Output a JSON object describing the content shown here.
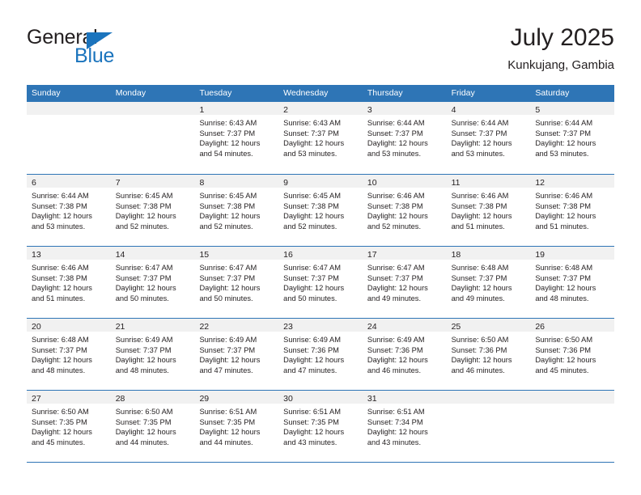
{
  "brand": {
    "name_top": "General",
    "name_bottom": "Blue",
    "triangle_color": "#1b74bd"
  },
  "header": {
    "title": "July 2025",
    "subtitle": "Kunkujang, Gambia"
  },
  "theme": {
    "header_blue": "#2e75b6",
    "daynum_strip": "#f1f1f1",
    "text": "#231f20"
  },
  "weekday_labels": [
    "Sunday",
    "Monday",
    "Tuesday",
    "Wednesday",
    "Thursday",
    "Friday",
    "Saturday"
  ],
  "weeks": [
    [
      {
        "day": "",
        "sunrise": "",
        "sunset": "",
        "daylight": ""
      },
      {
        "day": "",
        "sunrise": "",
        "sunset": "",
        "daylight": ""
      },
      {
        "day": "1",
        "sunrise": "Sunrise: 6:43 AM",
        "sunset": "Sunset: 7:37 PM",
        "daylight": "Daylight: 12 hours and 54 minutes."
      },
      {
        "day": "2",
        "sunrise": "Sunrise: 6:43 AM",
        "sunset": "Sunset: 7:37 PM",
        "daylight": "Daylight: 12 hours and 53 minutes."
      },
      {
        "day": "3",
        "sunrise": "Sunrise: 6:44 AM",
        "sunset": "Sunset: 7:37 PM",
        "daylight": "Daylight: 12 hours and 53 minutes."
      },
      {
        "day": "4",
        "sunrise": "Sunrise: 6:44 AM",
        "sunset": "Sunset: 7:37 PM",
        "daylight": "Daylight: 12 hours and 53 minutes."
      },
      {
        "day": "5",
        "sunrise": "Sunrise: 6:44 AM",
        "sunset": "Sunset: 7:37 PM",
        "daylight": "Daylight: 12 hours and 53 minutes."
      }
    ],
    [
      {
        "day": "6",
        "sunrise": "Sunrise: 6:44 AM",
        "sunset": "Sunset: 7:38 PM",
        "daylight": "Daylight: 12 hours and 53 minutes."
      },
      {
        "day": "7",
        "sunrise": "Sunrise: 6:45 AM",
        "sunset": "Sunset: 7:38 PM",
        "daylight": "Daylight: 12 hours and 52 minutes."
      },
      {
        "day": "8",
        "sunrise": "Sunrise: 6:45 AM",
        "sunset": "Sunset: 7:38 PM",
        "daylight": "Daylight: 12 hours and 52 minutes."
      },
      {
        "day": "9",
        "sunrise": "Sunrise: 6:45 AM",
        "sunset": "Sunset: 7:38 PM",
        "daylight": "Daylight: 12 hours and 52 minutes."
      },
      {
        "day": "10",
        "sunrise": "Sunrise: 6:46 AM",
        "sunset": "Sunset: 7:38 PM",
        "daylight": "Daylight: 12 hours and 52 minutes."
      },
      {
        "day": "11",
        "sunrise": "Sunrise: 6:46 AM",
        "sunset": "Sunset: 7:38 PM",
        "daylight": "Daylight: 12 hours and 51 minutes."
      },
      {
        "day": "12",
        "sunrise": "Sunrise: 6:46 AM",
        "sunset": "Sunset: 7:38 PM",
        "daylight": "Daylight: 12 hours and 51 minutes."
      }
    ],
    [
      {
        "day": "13",
        "sunrise": "Sunrise: 6:46 AM",
        "sunset": "Sunset: 7:38 PM",
        "daylight": "Daylight: 12 hours and 51 minutes."
      },
      {
        "day": "14",
        "sunrise": "Sunrise: 6:47 AM",
        "sunset": "Sunset: 7:37 PM",
        "daylight": "Daylight: 12 hours and 50 minutes."
      },
      {
        "day": "15",
        "sunrise": "Sunrise: 6:47 AM",
        "sunset": "Sunset: 7:37 PM",
        "daylight": "Daylight: 12 hours and 50 minutes."
      },
      {
        "day": "16",
        "sunrise": "Sunrise: 6:47 AM",
        "sunset": "Sunset: 7:37 PM",
        "daylight": "Daylight: 12 hours and 50 minutes."
      },
      {
        "day": "17",
        "sunrise": "Sunrise: 6:47 AM",
        "sunset": "Sunset: 7:37 PM",
        "daylight": "Daylight: 12 hours and 49 minutes."
      },
      {
        "day": "18",
        "sunrise": "Sunrise: 6:48 AM",
        "sunset": "Sunset: 7:37 PM",
        "daylight": "Daylight: 12 hours and 49 minutes."
      },
      {
        "day": "19",
        "sunrise": "Sunrise: 6:48 AM",
        "sunset": "Sunset: 7:37 PM",
        "daylight": "Daylight: 12 hours and 48 minutes."
      }
    ],
    [
      {
        "day": "20",
        "sunrise": "Sunrise: 6:48 AM",
        "sunset": "Sunset: 7:37 PM",
        "daylight": "Daylight: 12 hours and 48 minutes."
      },
      {
        "day": "21",
        "sunrise": "Sunrise: 6:49 AM",
        "sunset": "Sunset: 7:37 PM",
        "daylight": "Daylight: 12 hours and 48 minutes."
      },
      {
        "day": "22",
        "sunrise": "Sunrise: 6:49 AM",
        "sunset": "Sunset: 7:37 PM",
        "daylight": "Daylight: 12 hours and 47 minutes."
      },
      {
        "day": "23",
        "sunrise": "Sunrise: 6:49 AM",
        "sunset": "Sunset: 7:36 PM",
        "daylight": "Daylight: 12 hours and 47 minutes."
      },
      {
        "day": "24",
        "sunrise": "Sunrise: 6:49 AM",
        "sunset": "Sunset: 7:36 PM",
        "daylight": "Daylight: 12 hours and 46 minutes."
      },
      {
        "day": "25",
        "sunrise": "Sunrise: 6:50 AM",
        "sunset": "Sunset: 7:36 PM",
        "daylight": "Daylight: 12 hours and 46 minutes."
      },
      {
        "day": "26",
        "sunrise": "Sunrise: 6:50 AM",
        "sunset": "Sunset: 7:36 PM",
        "daylight": "Daylight: 12 hours and 45 minutes."
      }
    ],
    [
      {
        "day": "27",
        "sunrise": "Sunrise: 6:50 AM",
        "sunset": "Sunset: 7:35 PM",
        "daylight": "Daylight: 12 hours and 45 minutes."
      },
      {
        "day": "28",
        "sunrise": "Sunrise: 6:50 AM",
        "sunset": "Sunset: 7:35 PM",
        "daylight": "Daylight: 12 hours and 44 minutes."
      },
      {
        "day": "29",
        "sunrise": "Sunrise: 6:51 AM",
        "sunset": "Sunset: 7:35 PM",
        "daylight": "Daylight: 12 hours and 44 minutes."
      },
      {
        "day": "30",
        "sunrise": "Sunrise: 6:51 AM",
        "sunset": "Sunset: 7:35 PM",
        "daylight": "Daylight: 12 hours and 43 minutes."
      },
      {
        "day": "31",
        "sunrise": "Sunrise: 6:51 AM",
        "sunset": "Sunset: 7:34 PM",
        "daylight": "Daylight: 12 hours and 43 minutes."
      },
      {
        "day": "",
        "sunrise": "",
        "sunset": "",
        "daylight": ""
      },
      {
        "day": "",
        "sunrise": "",
        "sunset": "",
        "daylight": ""
      }
    ]
  ]
}
